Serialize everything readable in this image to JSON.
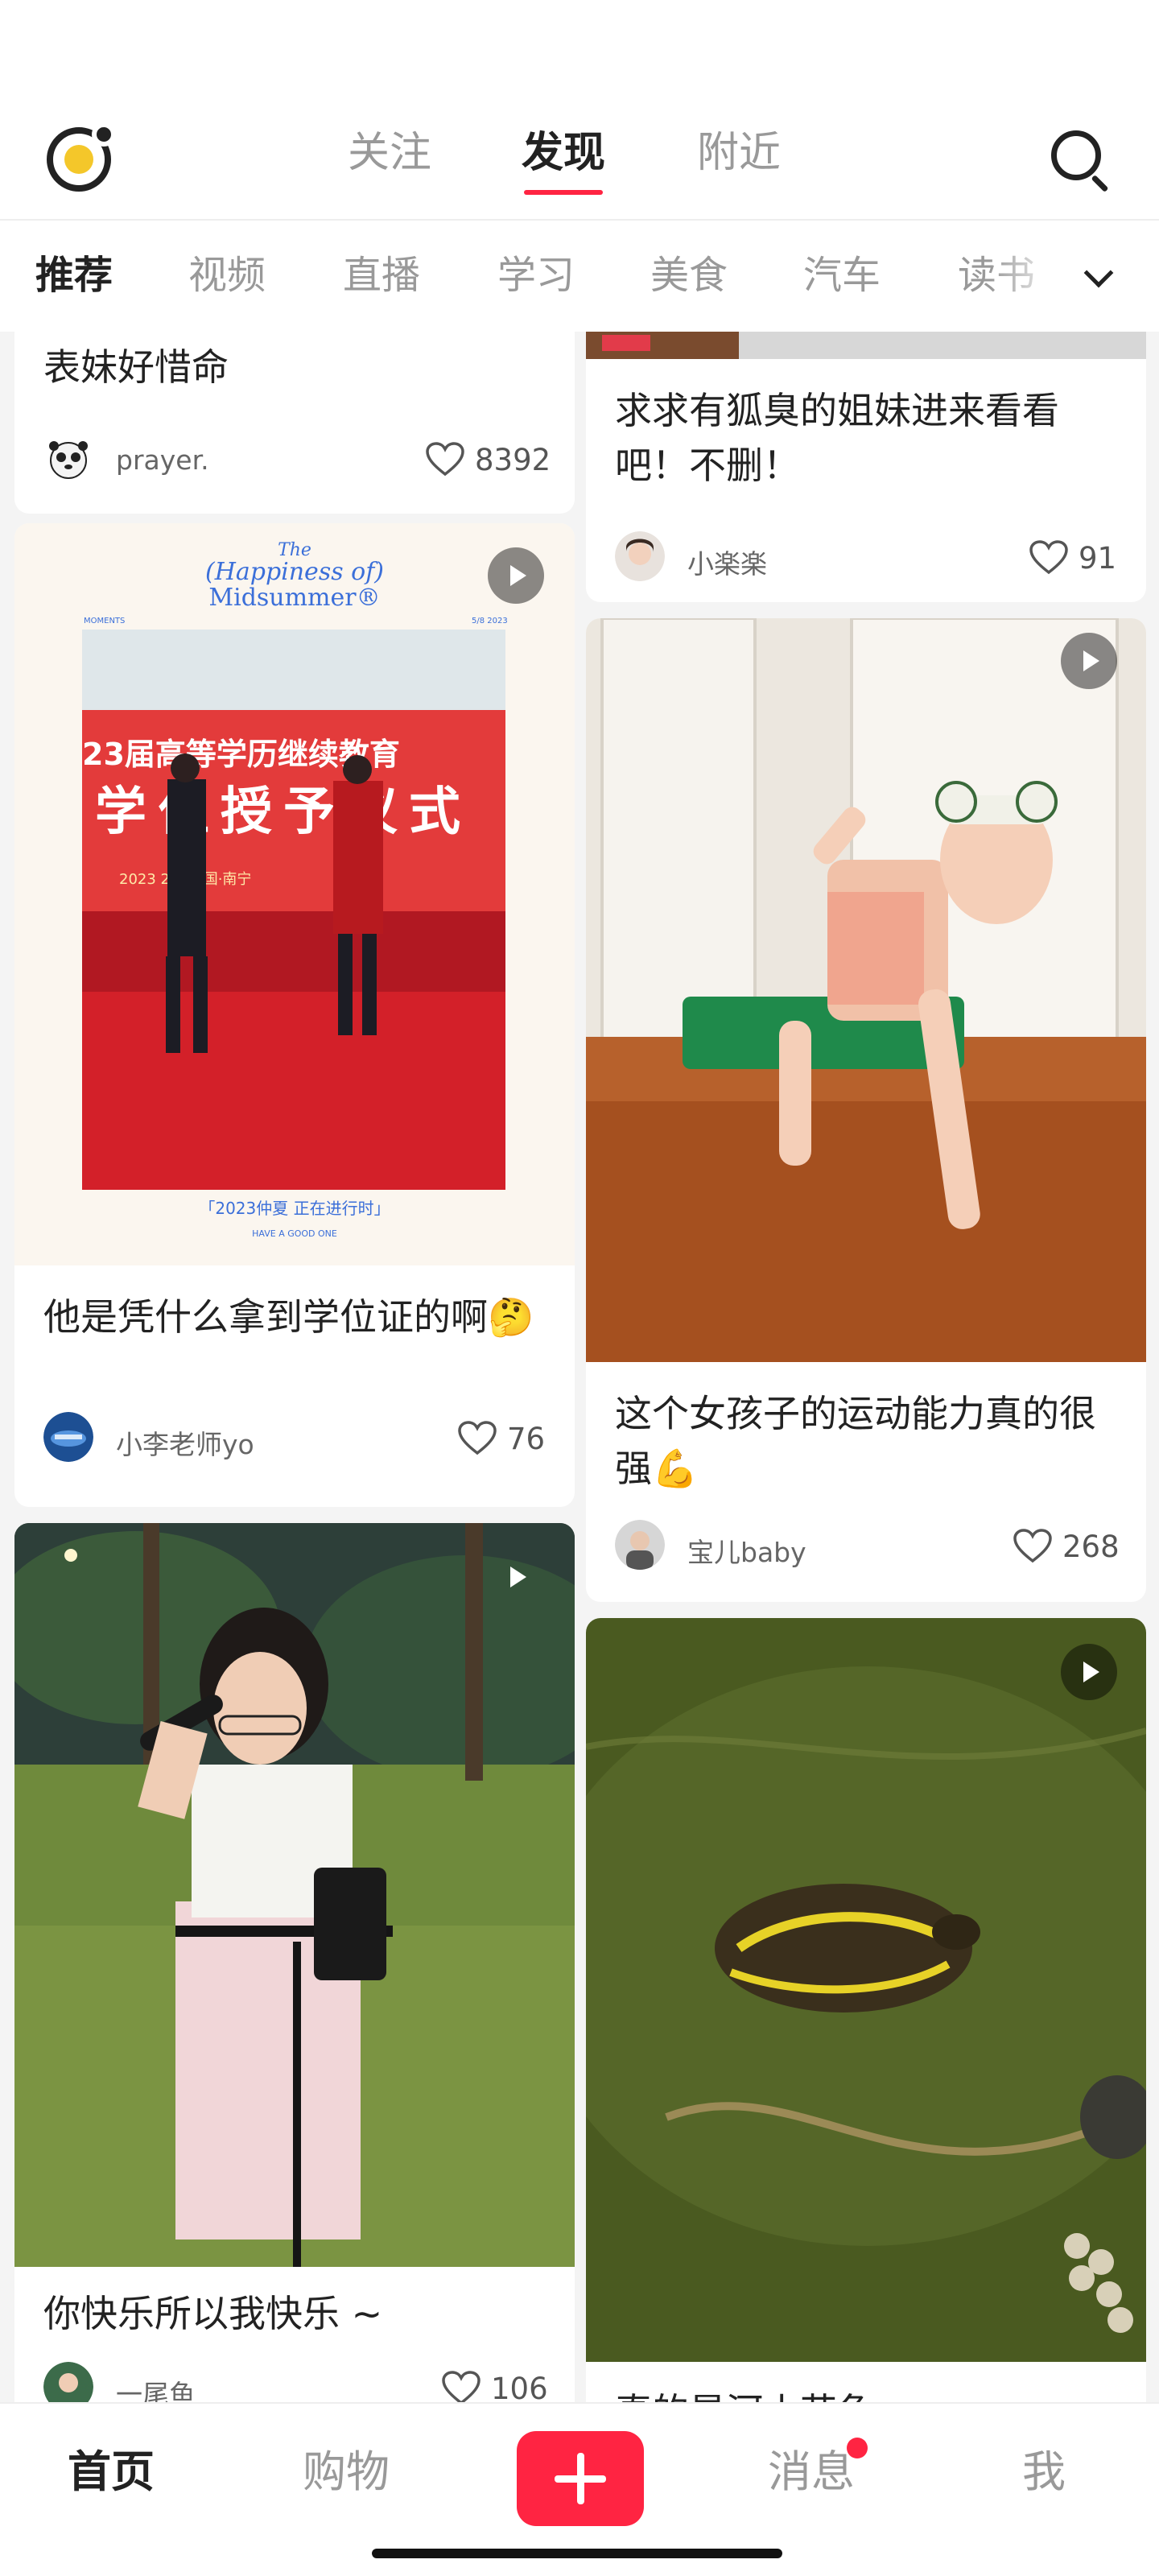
{
  "header": {
    "tabs": [
      {
        "label": "关注"
      },
      {
        "label": "发现"
      },
      {
        "label": "附近"
      }
    ],
    "active_tab": "发现"
  },
  "categories": {
    "items": [
      "推荐",
      "视频",
      "直播",
      "学习",
      "美食",
      "汽车",
      "读书"
    ],
    "active": "推荐"
  },
  "feed": {
    "left": [
      {
        "title": "表妹好惜命",
        "author": "prayer.",
        "likes": "8392"
      },
      {
        "title": "他是凭什么拿到学位证的啊🤔",
        "author": "小李老师yo",
        "likes": "76",
        "video": true,
        "image_text": {
          "brand_line1": "The",
          "brand_line2": "(Happiness of)",
          "brand_line3": "Midsummer®",
          "left_tag": "MOMENTS",
          "right_tag": "5/8 2023",
          "banner_line1": "23届高等学历继续教育",
          "banner_line2": "学位授予仪式",
          "banner_line3": "2023    2日   中国·南宁",
          "caption": "「2023仲夏 正在进行时」",
          "sub_caption": "HAVE A GOOD ONE"
        }
      },
      {
        "title": "你快乐所以我快乐 ~",
        "author": "一尾鱼",
        "likes": "106",
        "video": true
      }
    ],
    "right": [
      {
        "title": "求求有狐臭的姐妹进来看看吧！不删！",
        "author": "小楽楽",
        "likes": "91"
      },
      {
        "title": "这个女孩子的运动能力真的很强💪",
        "author": "宝儿baby",
        "likes": "268",
        "video": true
      },
      {
        "title": "真的是河小花龟",
        "video": true
      }
    ]
  },
  "bottom_nav": {
    "home": "首页",
    "shop": "购物",
    "messages": "消息",
    "me": "我"
  },
  "colors": {
    "accent": "#ff2442",
    "logo_yellow": "#f4c72a",
    "text": "#222222",
    "muted": "#999999"
  },
  "icons": [
    "logo-icon",
    "search-icon",
    "chevron-down-icon",
    "play-icon",
    "heart-icon",
    "plus-icon"
  ]
}
